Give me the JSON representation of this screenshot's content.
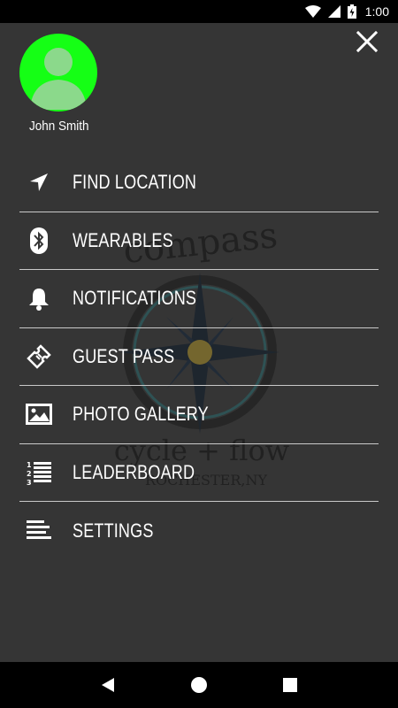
{
  "status_bar": {
    "time": "1:00",
    "icons": [
      "wifi-icon",
      "signal-icon",
      "battery-charging-icon"
    ]
  },
  "drawer": {
    "close_icon": "close-icon",
    "user": {
      "name": "John Smith",
      "avatar_color": "#15ff15"
    },
    "menu_items": [
      {
        "label": "FIND LOCATION",
        "icon": "location-arrow-icon"
      },
      {
        "label": "WEARABLES",
        "icon": "bluetooth-icon"
      },
      {
        "label": "NOTIFICATIONS",
        "icon": "bell-icon"
      },
      {
        "label": "GUEST PASS",
        "icon": "ticket-icon"
      },
      {
        "label": "PHOTO GALLERY",
        "icon": "image-icon"
      },
      {
        "label": "LEADERBOARD",
        "icon": "numbered-list-icon"
      },
      {
        "label": "SETTINGS",
        "icon": "settings-lines-icon"
      }
    ],
    "watermark": {
      "top_text": "compass",
      "bottom_text": "cycle + flow",
      "city_text": "ROCHESTER,NY"
    }
  },
  "nav_bar": {
    "buttons": [
      "back-icon",
      "home-icon",
      "recents-icon"
    ]
  },
  "colors": {
    "drawer_bg": "#353535",
    "divider": "#c9c9c9",
    "text": "#ffffff"
  }
}
